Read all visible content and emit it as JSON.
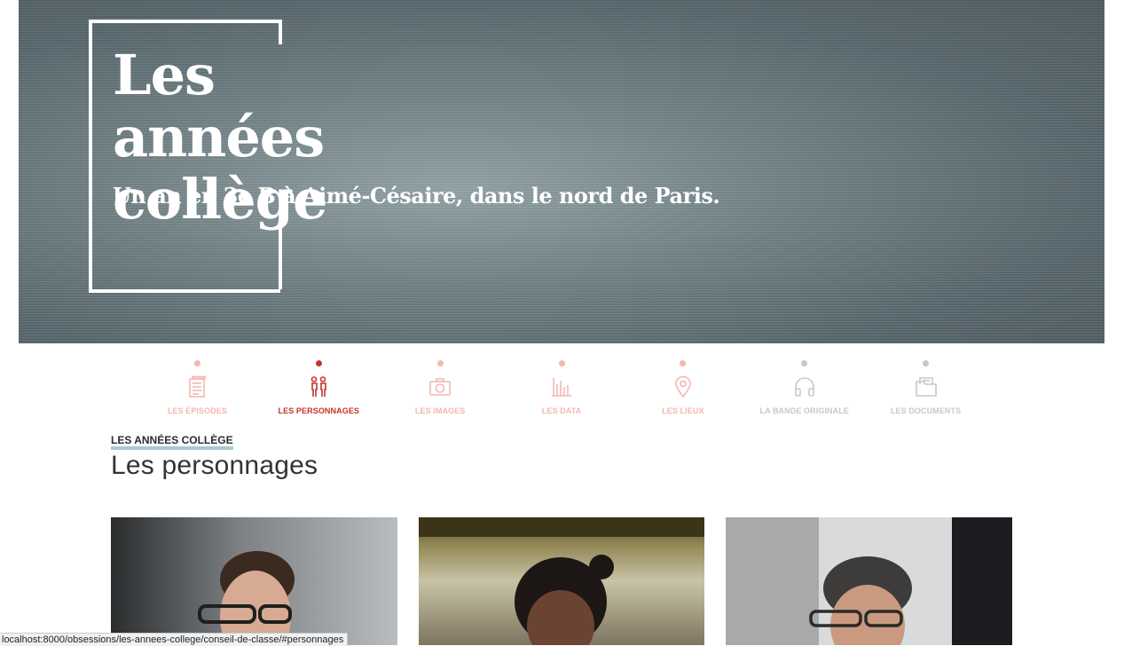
{
  "hero": {
    "title_line1": "Les années",
    "title_line2": "collège",
    "subtitle": "Un an en 3e B à Aimé-Césaire, dans le nord de Paris."
  },
  "nav": {
    "items": [
      {
        "label": "LES ÉPISODES",
        "icon": "document-stack-icon",
        "dot_color": "#f3b7b0",
        "text_color": "#f3b7b0"
      },
      {
        "label": "LES PERSONNAGES",
        "icon": "people-icon",
        "dot_color": "#c4352a",
        "text_color": "#c4352a"
      },
      {
        "label": "LES IMAGES",
        "icon": "camera-icon",
        "dot_color": "#f3b7b0",
        "text_color": "#f3b7b0"
      },
      {
        "label": "LES DATA",
        "icon": "bar-chart-icon",
        "dot_color": "#f3b7b0",
        "text_color": "#f3b7b0"
      },
      {
        "label": "LES LIEUX",
        "icon": "map-pin-icon",
        "dot_color": "#f3b7b0",
        "text_color": "#f3b7b0"
      },
      {
        "label": "LA BANDE ORIGINALE",
        "icon": "headphones-icon",
        "dot_color": "#c8c8c8",
        "text_color": "#c8c8c8"
      },
      {
        "label": "LES DOCUMENTS",
        "icon": "folder-icon",
        "dot_color": "#c8c8c8",
        "text_color": "#c8c8c8"
      }
    ]
  },
  "kicker": "LES ANNÉES COLLÈGE",
  "page_title": "Les personnages",
  "status_bar": "localhost:8000/obsessions/les-annees-college/conseil-de-classe/#personnages",
  "colors": {
    "accent": "#c4352a",
    "inactive_accent": "#f3b7b0",
    "inactive_grey": "#c8c8c8",
    "kicker_underline": "#a9c9d2"
  }
}
